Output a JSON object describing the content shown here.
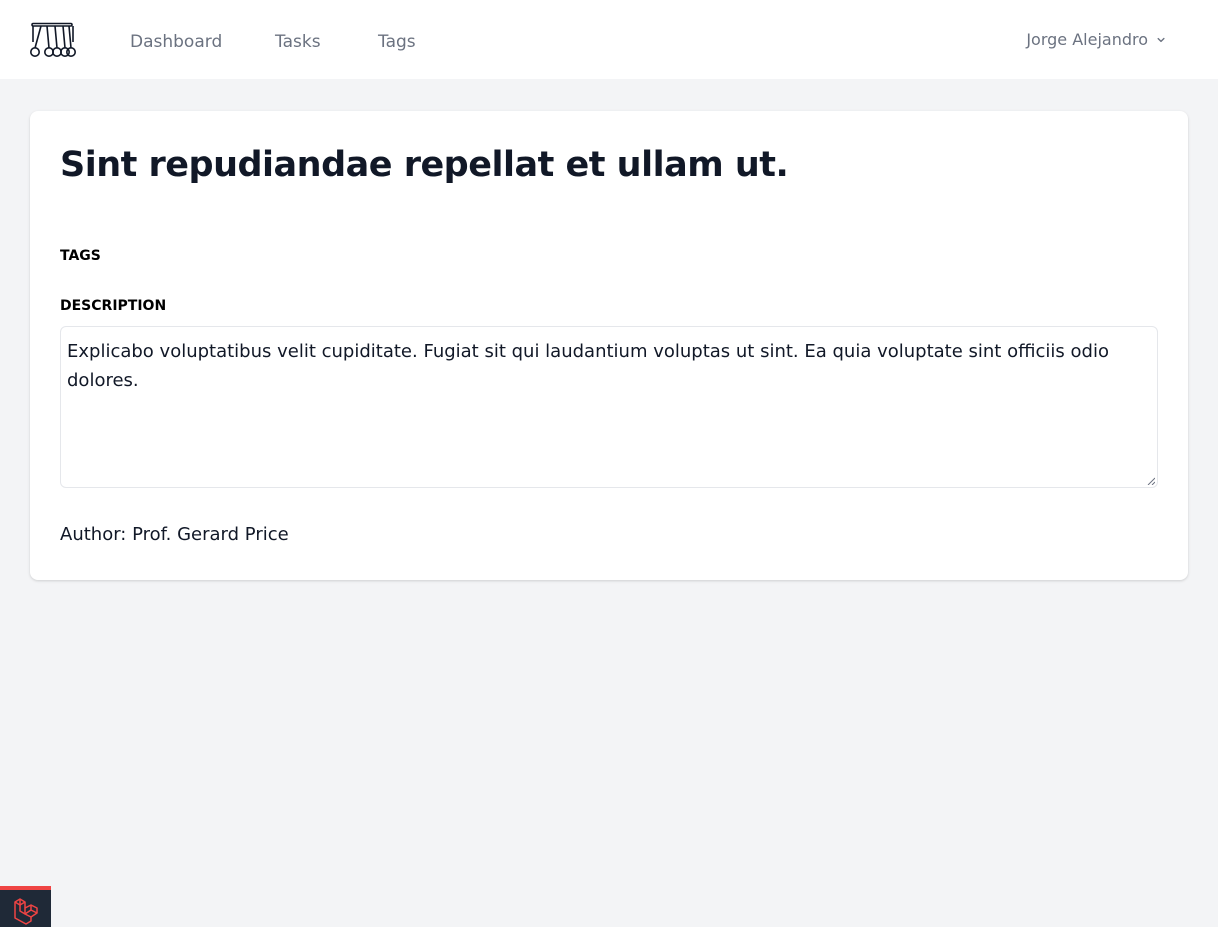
{
  "nav": {
    "logo_icon": "cradle-logo-icon",
    "links": [
      {
        "label": "Dashboard"
      },
      {
        "label": "Tasks"
      },
      {
        "label": "Tags"
      }
    ],
    "user_name": "Jorge Alejandro",
    "user_chevron_icon": "chevron-down-icon"
  },
  "task": {
    "title": "Sint repudiandae repellat et ullam ut.",
    "tags_label": "TAGS",
    "description_label": "DESCRIPTION",
    "description": "Explicabo voluptatibus velit cupiditate. Fugiat sit qui laudantium voluptas ut sint. Ea quia voluptate sint officiis odio dolores.",
    "author": "Author: Prof. Gerard Price"
  },
  "debug_badge": {
    "icon": "laravel-icon",
    "accent_color": "#ef4444"
  },
  "colors": {
    "page_bg": "#f3f4f6",
    "nav_text": "#6b7280",
    "heading": "#111827"
  }
}
